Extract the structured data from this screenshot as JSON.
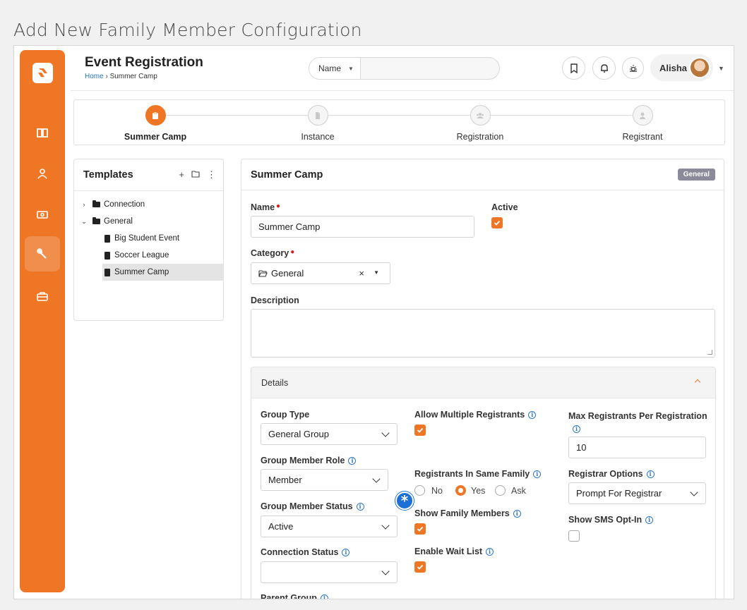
{
  "outer_title": "Add New Family Member Configuration",
  "header": {
    "title": "Event Registration",
    "breadcrumb_home": "Home",
    "breadcrumb_sep": " › ",
    "breadcrumb_current": "Summer Camp",
    "search_type": "Name",
    "user_name": "Alisha"
  },
  "sidebar": {
    "items": [
      {
        "icon": "book-icon"
      },
      {
        "icon": "person-icon"
      },
      {
        "icon": "money-icon"
      },
      {
        "icon": "wrench-icon",
        "active": true
      },
      {
        "icon": "briefcase-icon"
      }
    ]
  },
  "steps": [
    {
      "label": "Summer Camp",
      "active": true
    },
    {
      "label": "Instance"
    },
    {
      "label": "Registration"
    },
    {
      "label": "Registrant"
    }
  ],
  "templates": {
    "title": "Templates",
    "tree": [
      {
        "label": "Connection",
        "type": "folder",
        "expanded": false
      },
      {
        "label": "General",
        "type": "folder",
        "expanded": true
      },
      {
        "label": "Big Student Event",
        "type": "item"
      },
      {
        "label": "Soccer League",
        "type": "item"
      },
      {
        "label": "Summer Camp",
        "type": "item",
        "selected": true
      }
    ]
  },
  "card": {
    "title": "Summer Camp",
    "badge": "General",
    "name_label": "Name",
    "name_value": "Summer Camp",
    "active_label": "Active",
    "category_label": "Category",
    "category_value": "General",
    "description_label": "Description",
    "details_title": "Details",
    "group_type_label": "Group Type",
    "group_type_value": "General Group",
    "group_member_role_label": "Group Member Role",
    "group_member_role_value": "Member",
    "group_member_status_label": "Group Member Status",
    "group_member_status_value": "Active",
    "connection_status_label": "Connection Status",
    "connection_status_value": "",
    "allow_multiple_label": "Allow Multiple Registrants",
    "same_family_label": "Registrants In Same Family",
    "same_family_options": [
      "No",
      "Yes",
      "Ask"
    ],
    "same_family_selected": "Yes",
    "show_family_label": "Show Family Members",
    "wait_list_label": "Enable Wait List",
    "max_registrants_label": "Max Registrants Per Registration",
    "max_registrants_value": "10",
    "registrar_options_label": "Registrar Options",
    "registrar_options_value": "Prompt For Registrar",
    "sms_opt_in_label": "Show SMS Opt-In",
    "partial_label": "Parent Group"
  },
  "colors": {
    "accent": "#ee7625",
    "link": "#2a76c4",
    "badge": "#8a8a9a",
    "callout": "#1d6fd6"
  }
}
